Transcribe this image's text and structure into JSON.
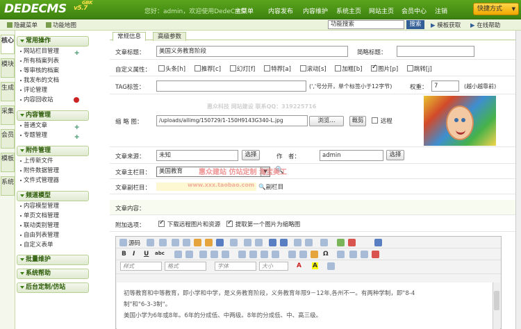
{
  "header": {
    "logo": "DEDECMS",
    "version": "v5.7",
    "badge": "GBK",
    "welcome": "您好：admin，欢迎使用DedeCMS!",
    "nav": [
      "主菜单",
      "内容发布",
      "内容维护",
      "系统主页",
      "网站主页",
      "会员中心",
      "注销"
    ],
    "quick": "快捷方式"
  },
  "subbar": {
    "hide_menu": "隐藏菜单",
    "func_map": "功能地图",
    "search_placeholder": "功能搜索",
    "search_btn": "搜索",
    "template_get": "模板获取",
    "online_help": "在线帮助"
  },
  "vtabs": [
    "核心",
    "模块",
    "生成",
    "采集",
    "会员",
    "模板",
    "系统"
  ],
  "menu": {
    "sec1": "常用操作",
    "sec1_items": [
      "网站栏目管理",
      "所有档案列表",
      "等审核的档案",
      "我发布的文档",
      "评论管理",
      "内容回收站"
    ],
    "sec2": "内容管理",
    "sec2_items": [
      "普通文章",
      "专题管理"
    ],
    "sec3": "附件管理",
    "sec3_items": [
      "上传新文件",
      "附件数据管理",
      "文件式管理器"
    ],
    "sec4": "频道模型",
    "sec4_items": [
      "内容模型管理",
      "单页文档管理",
      "联动类别管理",
      "自由列表管理",
      "自定义表单"
    ],
    "sec5": "批量维护",
    "sec6": "系统帮助",
    "sec7": "后台定制/仿站"
  },
  "tabs": {
    "basic": "常规信息",
    "advanced": "高级参数"
  },
  "form": {
    "title_label": "文章标题：",
    "title_value": "美国义务教育阶段",
    "short_title_label": "简略标题：",
    "attr_label": "自定义属性：",
    "attrs": [
      "头条[h]",
      "推荐[c]",
      "幻灯[f]",
      "特荐[a]",
      "滚动[s]",
      "加粗[b]",
      "图片[p]",
      "跳转[j]"
    ],
    "tag_label": "TAG标签：",
    "tag_hint": "(','号分开，单个标签小于12字节)",
    "weight_label": "权重：",
    "weight_value": "7",
    "weight_hint": "(越小越靠前)",
    "thumb_label": "缩 略 图：",
    "thumb_value": "/uploads/allimg/150729/1-150H9143G340-L.jpg",
    "browse_btn": "浏览...",
    "crop_btn": "裁剪",
    "remote_label": "远程",
    "source_label": "文章来源：",
    "source_value": "未知",
    "select_btn": "选择",
    "author_label": "作　者：",
    "author_value": "admin",
    "main_col_label": "文章主栏目：",
    "main_col_value": "美国教育",
    "sub_col_label": "文章副栏目：",
    "sub_col_link": "副栏目",
    "content_label": "文章内容：",
    "extra_label": "附加选项：",
    "download_remote": "下载远程图片和资源",
    "first_as_thumb": "提取第一个图片为缩略图"
  },
  "watermarks": [
    "惠众科技 网站建设 联系QQ：319225716",
    "惠众建站 仿站定制 淘宝美工",
    "www.xxx.taobao.com"
  ],
  "editor": {
    "source": "源码",
    "style": "样式",
    "format": "格式",
    "font": "字体",
    "size": "大小",
    "paragraphs": [
      "初等教育和中等教育，即小学和中学，是义务教育阶段，义务教育年限9－12年,各州不一。有两种学制，即\"8-4",
      "制\"和\"6-3-3制\"。",
      "美国小学为6年或8年。6年的分成低、中两级。8年的分成低、中、高三级。"
    ]
  }
}
